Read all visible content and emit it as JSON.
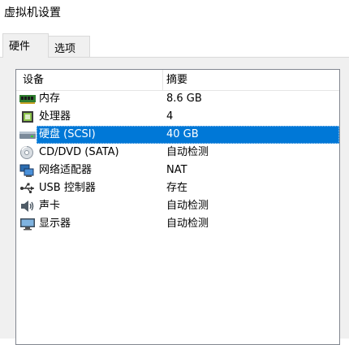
{
  "window": {
    "title": "虚拟机设置"
  },
  "tabs": [
    {
      "label": "硬件",
      "active": true
    },
    {
      "label": "选项",
      "active": false
    }
  ],
  "device_list": {
    "columns": {
      "device": "设备",
      "summary": "摘要"
    },
    "rows": [
      {
        "icon": "memory-icon",
        "device": "内存",
        "summary": "8.6 GB",
        "selected": false
      },
      {
        "icon": "processor-icon",
        "device": "处理器",
        "summary": "4",
        "selected": false
      },
      {
        "icon": "hard-disk-icon",
        "device": "硬盘 (SCSI)",
        "summary": "40 GB",
        "selected": true
      },
      {
        "icon": "cd-dvd-icon",
        "device": "CD/DVD (SATA)",
        "summary": "自动检测",
        "selected": false
      },
      {
        "icon": "network-adapter-icon",
        "device": "网络适配器",
        "summary": "NAT",
        "selected": false
      },
      {
        "icon": "usb-icon",
        "device": "USB 控制器",
        "summary": "存在",
        "selected": false
      },
      {
        "icon": "sound-card-icon",
        "device": "声卡",
        "summary": "自动检测",
        "selected": false
      },
      {
        "icon": "display-icon",
        "device": "显示器",
        "summary": "自动检测",
        "selected": false
      }
    ]
  },
  "colors": {
    "selection": "#0078d7",
    "panel": "#f0f0f0"
  }
}
